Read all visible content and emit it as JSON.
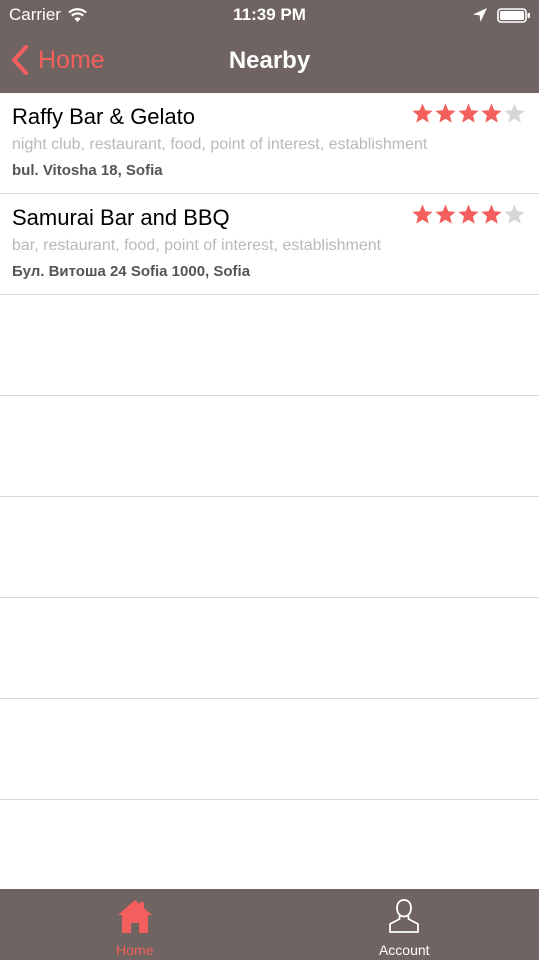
{
  "status_bar": {
    "carrier": "Carrier",
    "time": "11:39 PM",
    "icons": [
      "wifi-icon",
      "location-arrow-icon",
      "battery-icon"
    ]
  },
  "nav": {
    "back_label": "Home",
    "back_icon": "chevron-left-icon",
    "title": "Nearby"
  },
  "places": [
    {
      "name": "Raffy Bar & Gelato",
      "types": "night club, restaurant, food, point of interest, establishment",
      "address": "bul. Vitosha 18, Sofia",
      "rating_stars": 4,
      "max_stars": 5
    },
    {
      "name": "Samurai Bar and BBQ",
      "types": "bar, restaurant, food, point of interest, establishment",
      "address": "Бул. Витоша 24 Sofia 1000, Sofia",
      "rating_stars": 4,
      "max_stars": 5
    }
  ],
  "empty_rows": 6,
  "tabs": [
    {
      "label": "Home",
      "icon": "home-icon",
      "active": true
    },
    {
      "label": "Account",
      "icon": "user-icon",
      "active": false
    }
  ],
  "colors": {
    "bar_background": "#6f6461",
    "accent": "#f25f5c",
    "star_filled": "#f25f5c",
    "star_empty": "#d6d6d6",
    "separator": "#d8d8d8",
    "secondary_text": "#b9b9b9"
  }
}
